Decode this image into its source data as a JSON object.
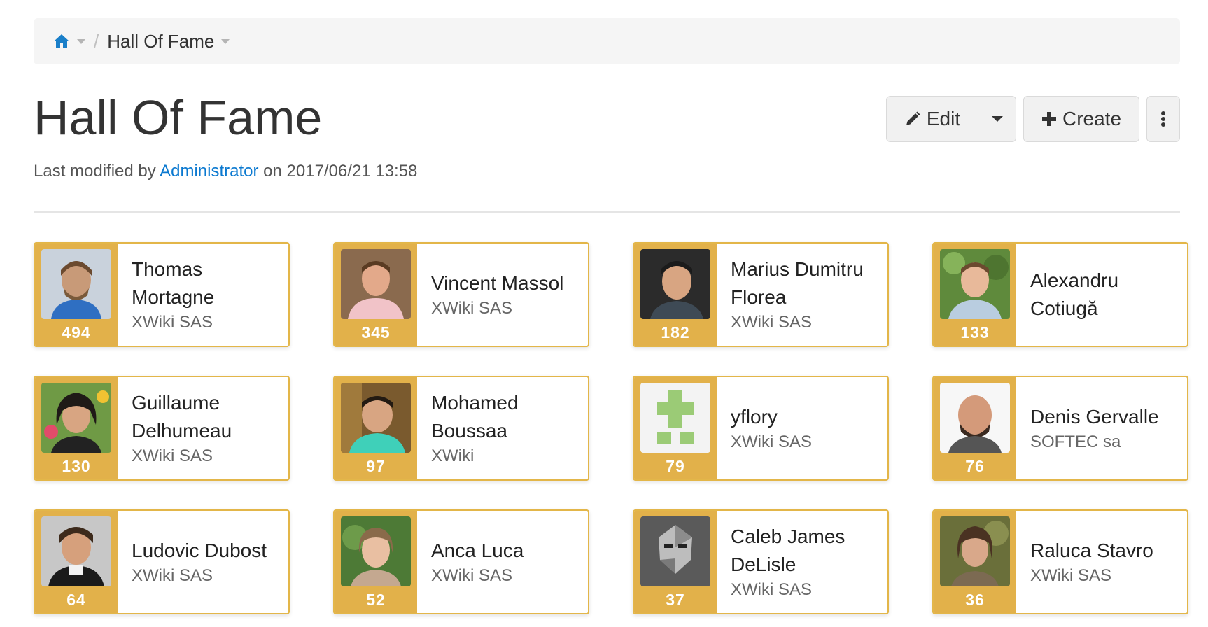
{
  "breadcrumb": {
    "current": "Hall Of Fame"
  },
  "page": {
    "title": "Hall Of Fame",
    "meta_prefix": "Last modified by",
    "meta_author": "Administrator",
    "meta_suffix": "on 2017/06/21 13:58"
  },
  "actions": {
    "edit_label": "Edit",
    "create_label": "Create"
  },
  "icons": {
    "home": "home-icon",
    "edit": "pencil-icon",
    "create": "plus-icon",
    "more": "vertical-ellipsis-icon"
  },
  "colors": {
    "accent": "#e2b14a",
    "link": "#0b79d0",
    "home_icon": "#1a7fc9"
  },
  "contributors": [
    {
      "name_lines": [
        "Thomas",
        "Mortagne"
      ],
      "company": "XWiki SAS",
      "score": "494"
    },
    {
      "name_lines": [
        "Vincent Massol"
      ],
      "company": "XWiki SAS",
      "score": "345"
    },
    {
      "name_lines": [
        "Marius Dumitru",
        "Florea"
      ],
      "company": "XWiki SAS",
      "score": "182"
    },
    {
      "name_lines": [
        "Alexandru",
        "Cotiugă"
      ],
      "company": "",
      "score": "133"
    },
    {
      "name_lines": [
        "Guillaume",
        "Delhumeau"
      ],
      "company": "XWiki SAS",
      "score": "130"
    },
    {
      "name_lines": [
        "Mohamed",
        "Boussaa"
      ],
      "company": "XWiki",
      "score": "97"
    },
    {
      "name_lines": [
        "yflory"
      ],
      "company": "XWiki SAS",
      "score": "79"
    },
    {
      "name_lines": [
        "Denis Gervalle"
      ],
      "company": "SOFTEC sa",
      "score": "76"
    },
    {
      "name_lines": [
        "Ludovic Dubost"
      ],
      "company": "XWiki SAS",
      "score": "64"
    },
    {
      "name_lines": [
        "Anca Luca"
      ],
      "company": "XWiki SAS",
      "score": "52"
    },
    {
      "name_lines": [
        "Caleb James",
        "DeLisle"
      ],
      "company": "XWiki SAS",
      "score": "37"
    },
    {
      "name_lines": [
        "Raluca Stavro"
      ],
      "company": "XWiki SAS",
      "score": "36"
    }
  ]
}
